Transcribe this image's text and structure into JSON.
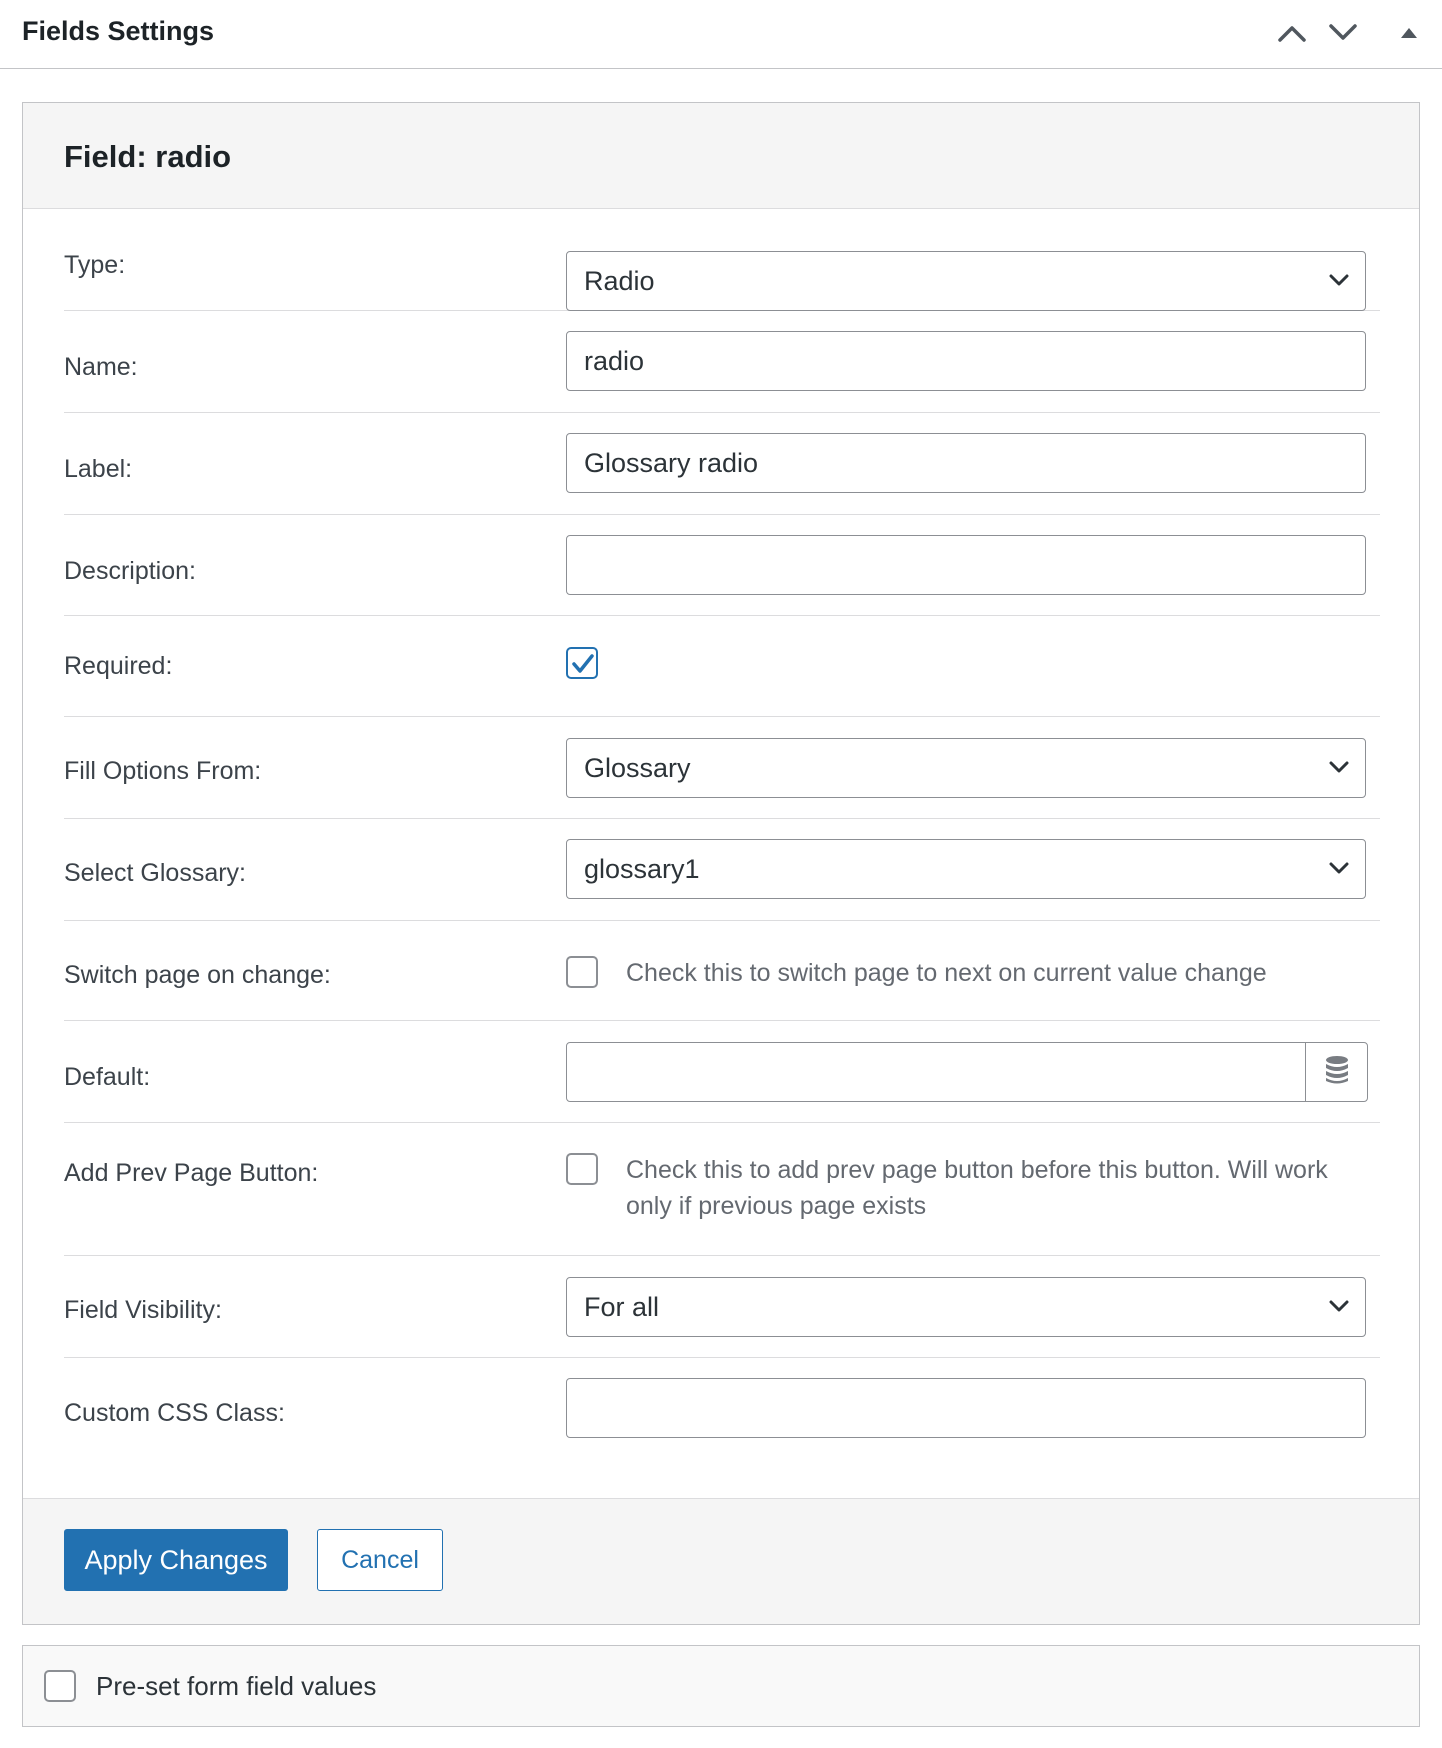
{
  "panel": {
    "title": "Fields Settings",
    "icons": [
      "chevron-up-icon",
      "chevron-down-icon",
      "triangle-up-icon"
    ]
  },
  "field": {
    "title": "Field: radio",
    "rows": {
      "type": {
        "label": "Type:",
        "value": "Radio"
      },
      "name": {
        "label": "Name:",
        "value": "radio"
      },
      "label": {
        "label": "Label:",
        "value": "Glossary radio"
      },
      "description": {
        "label": "Description:",
        "value": ""
      },
      "required": {
        "label": "Required:",
        "checked": true
      },
      "fill_options": {
        "label": "Fill Options From:",
        "value": "Glossary"
      },
      "select_glossary": {
        "label": "Select Glossary:",
        "value": "glossary1"
      },
      "switch_page": {
        "label": "Switch page on change:",
        "checked": false,
        "hint": "Check this to switch page to next on current value change"
      },
      "default": {
        "label": "Default:",
        "value": "",
        "icon": "database-icon"
      },
      "prev_page": {
        "label": "Add Prev Page Button:",
        "checked": false,
        "hint_line1": "Check this to add prev page button before this button. Will work",
        "hint_line2": "only if previous page exists"
      },
      "visibility": {
        "label": "Field Visibility:",
        "value": "For all"
      },
      "css_class": {
        "label": "Custom CSS Class:",
        "value": ""
      }
    },
    "buttons": {
      "apply": "Apply Changes",
      "cancel": "Cancel"
    }
  },
  "preset": {
    "label": "Pre-set form field values",
    "checked": false
  },
  "colors": {
    "accent": "#2271b1",
    "border": "#8c8f94",
    "header_bg": "#f5f5f5"
  }
}
